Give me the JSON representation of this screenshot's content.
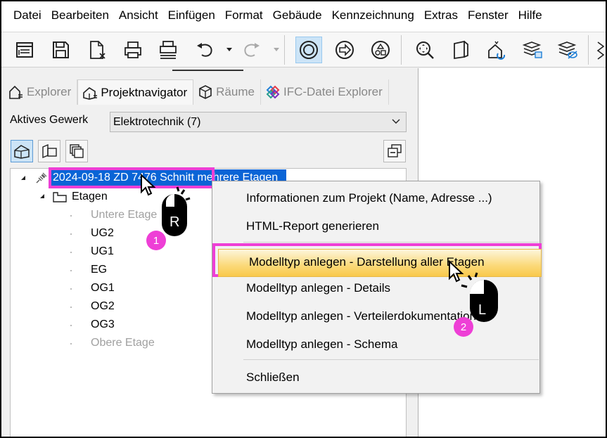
{
  "menu": [
    "Datei",
    "Bearbeiten",
    "Ansicht",
    "Einfügen",
    "Format",
    "Gebäude",
    "Kennzeichnung",
    "Extras",
    "Fenster",
    "Hilfe"
  ],
  "tabs": {
    "explorer": "Explorer",
    "projektnavigator": "Projektnavigator",
    "raeume": "Räume",
    "ifc": "IFC-Datei Explorer"
  },
  "gewerk": {
    "label": "Aktives Gewerk",
    "value": "Elektrotechnik (7)"
  },
  "tree": {
    "root": "2024-09-18 ZD 7476 Schnitt mehrere Etagen",
    "etagen": "Etagen",
    "floors": [
      "Untere Etage",
      "UG2",
      "UG1",
      "EG",
      "OG1",
      "OG2",
      "OG3",
      "Obere Etage"
    ]
  },
  "context_menu": {
    "items": [
      "Informationen zum Projekt (Name, Adresse ...)",
      "HTML-Report generieren",
      "Modelltyp anlegen - Darstellung aller Etagen",
      "Modelltyp anlegen - Details",
      "Modelltyp anlegen - Verteilerdokumentation",
      "Modelltyp anlegen - Schema",
      "Schließen"
    ]
  },
  "annotations": {
    "step1": "1",
    "step2": "2",
    "right_click_letter": "R",
    "left_click_letter": "L"
  },
  "colors": {
    "highlight": "#ee3fd6",
    "selection": "#0a64d6",
    "menu_hover": "#fbd979"
  }
}
